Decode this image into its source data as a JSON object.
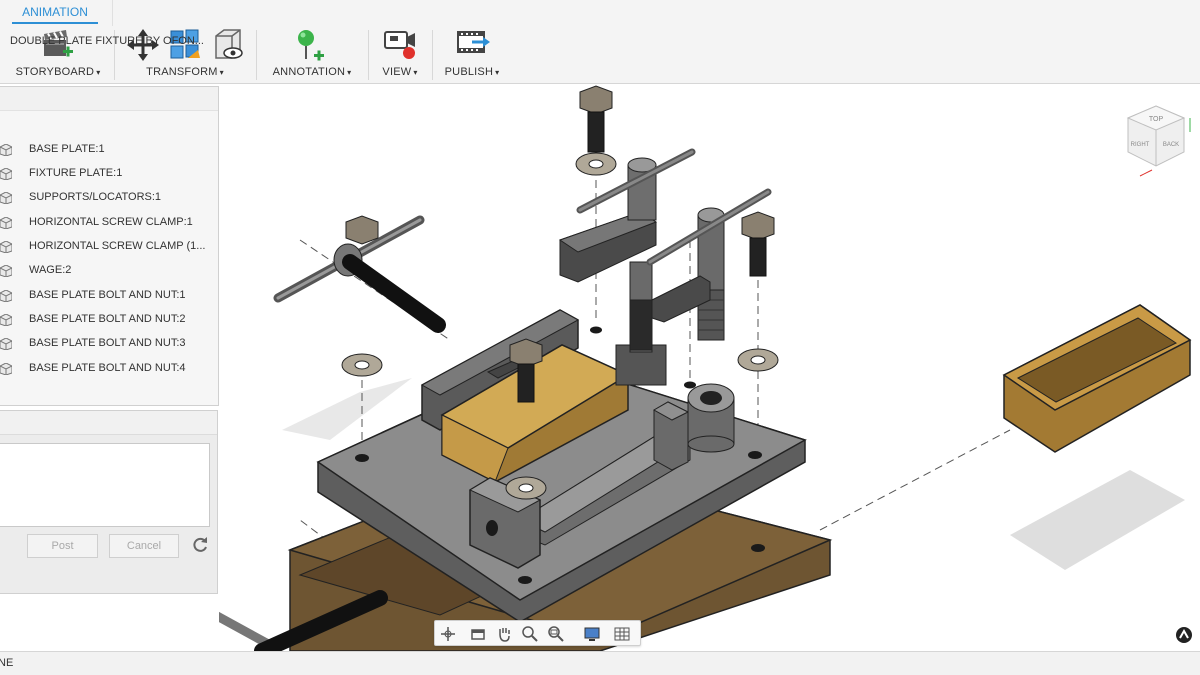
{
  "ribbon": {
    "active_tab": "ANIMATION",
    "groups": {
      "storyboard": "STORYBOARD",
      "transform": "TRANSFORM",
      "annotation": "ANNOTATION",
      "view": "VIEW",
      "publish": "PUBLISH"
    },
    "caret": "▾"
  },
  "browser": {
    "root": "DOUBLE PLATE FIXTURE BY OFON...",
    "items": [
      {
        "label": "BASE PLATE:1"
      },
      {
        "label": "FIXTURE PLATE:1"
      },
      {
        "label": "SUPPORTS/LOCATORS:1"
      },
      {
        "label": "HORIZONTAL SCREW CLAMP:1"
      },
      {
        "label": "HORIZONTAL SCREW CLAMP (1..."
      },
      {
        "label": "WAGE:2"
      },
      {
        "label": "BASE PLATE BOLT AND NUT:1"
      },
      {
        "label": "BASE PLATE BOLT AND NUT:2"
      },
      {
        "label": "BASE PLATE BOLT AND NUT:3"
      },
      {
        "label": "BASE PLATE BOLT AND NUT:4"
      }
    ]
  },
  "comments": {
    "post_label": "Post",
    "cancel_label": "Cancel"
  },
  "viewcube": {
    "top_face": "TOP",
    "right_face": "RIGHT",
    "back_face": "BACK"
  },
  "status": {
    "text": "NE"
  },
  "colors": {
    "accent": "#2d8fd5",
    "metal": "#8a8a8a",
    "wood": "#b98a3e",
    "base_wood": "#6e5532"
  },
  "nav_icons": [
    "orbit-icon",
    "look-at-icon",
    "pan-icon",
    "zoom-icon",
    "zoom-window-icon",
    "display-settings-icon",
    "grid-settings-icon"
  ]
}
